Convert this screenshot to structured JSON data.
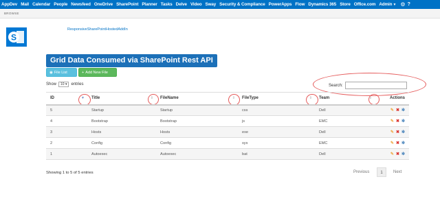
{
  "suitebar": {
    "items": [
      "AppDev",
      "Mail",
      "Calendar",
      "People",
      "Newsfeed",
      "OneDrive",
      "SharePoint",
      "Planner",
      "Tasks",
      "Delve",
      "Video",
      "Sway",
      "Security & Compliance",
      "PowerApps",
      "Flow",
      "Dynamics 365",
      "Store",
      "Office.com",
      "Admin"
    ],
    "help": "?"
  },
  "ribbon": {
    "browse": "BROWSE"
  },
  "breadcrumb": "ResponsiveSharePointHostedAddIn",
  "page_title": "Grid Data Consumed via SharePoint Rest API",
  "buttons": {
    "file_list": "File List",
    "add_new_file": "Add New File"
  },
  "show_entries": {
    "prefix": "Show",
    "value": "10",
    "suffix": "entries"
  },
  "search": {
    "label": "Search:",
    "value": ""
  },
  "table": {
    "headers": [
      "ID",
      "Title",
      "FileName",
      "FileType",
      "Team",
      "Actions"
    ],
    "rows": [
      [
        "5",
        "Startup",
        "Startup",
        "css",
        "Dell"
      ],
      [
        "4",
        "Bootstrap",
        "Bootstrap",
        "js",
        "EMC"
      ],
      [
        "3",
        "Hosts",
        "Hosts",
        "exe",
        "Dell"
      ],
      [
        "2",
        "Config",
        "Config",
        "sys",
        "EMC"
      ],
      [
        "1",
        "Autoexec",
        "Autoexec",
        "bat",
        "Dell"
      ]
    ]
  },
  "info": "Showing 1 to 5 of 5 entries",
  "pager": {
    "previous": "Previous",
    "current": "1",
    "next": "Next"
  },
  "colors": {
    "suitebar": "#0072c6",
    "title_bg": "#1c70b8",
    "info_button": "#5bc0de",
    "success_button": "#5cb85c",
    "annotation": "#e55a5a"
  }
}
